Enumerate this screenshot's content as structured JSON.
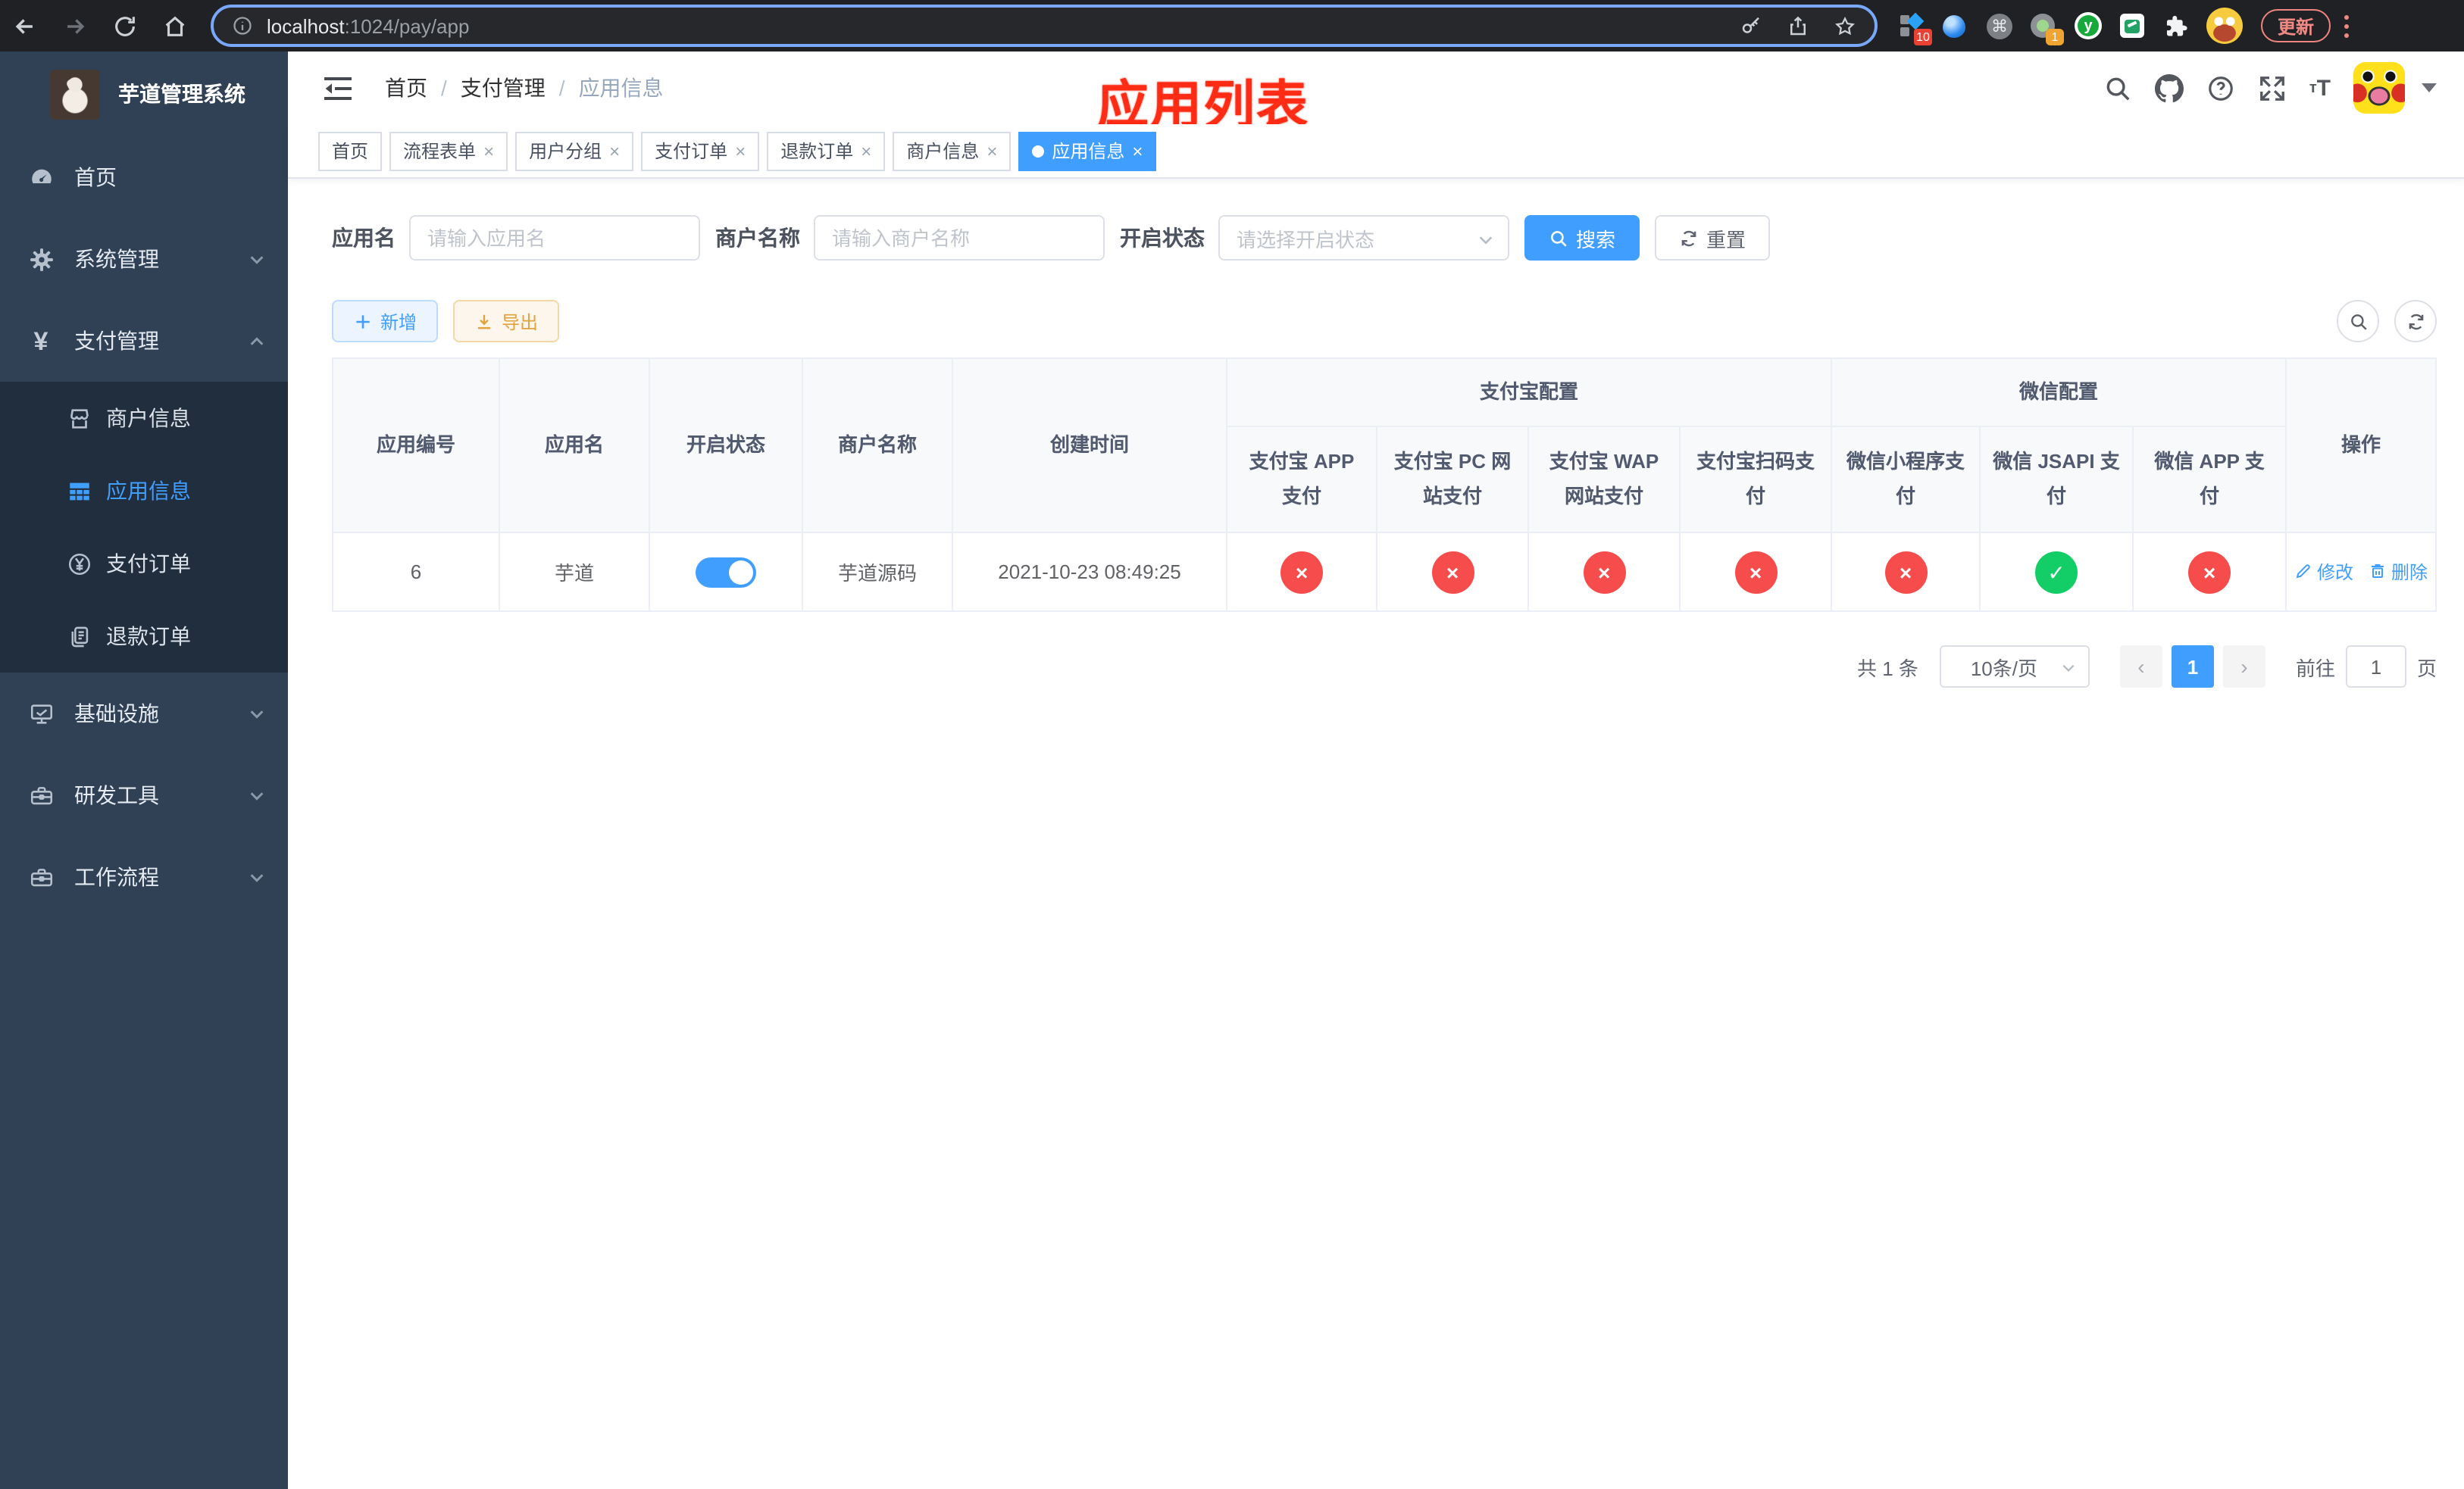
{
  "colors": {
    "primary": "#409eff",
    "danger": "#f64c4c",
    "success": "#13ce66",
    "warning": "#e2a23c",
    "annotation": "#fe2b15",
    "sidebar_bg": "#304156",
    "submenu_bg": "#212e3e"
  },
  "browser": {
    "url": {
      "host": "localhost",
      "rest": ":1024/pay/app"
    },
    "update_label": "更新",
    "ext_badge_blue": "10",
    "ext_badge_circle": "1",
    "ext_letter": "y"
  },
  "sidebar": {
    "title": "芋道管理系统",
    "items": [
      {
        "label": "首页"
      },
      {
        "label": "系统管理"
      },
      {
        "label": "支付管理"
      },
      {
        "label": "商户信息"
      },
      {
        "label": "应用信息"
      },
      {
        "label": "支付订单"
      },
      {
        "label": "退款订单"
      },
      {
        "label": "基础设施"
      },
      {
        "label": "研发工具"
      },
      {
        "label": "工作流程"
      }
    ]
  },
  "header": {
    "breadcrumb": [
      "首页",
      "支付管理",
      "应用信息"
    ],
    "separator": "/",
    "font_icon_small": "т",
    "font_icon_big": "T"
  },
  "annotation": {
    "text": "应用列表"
  },
  "tabs": {
    "items": [
      {
        "label": "首页"
      },
      {
        "label": "流程表单",
        "close": "×"
      },
      {
        "label": "用户分组",
        "close": "×"
      },
      {
        "label": "支付订单",
        "close": "×"
      },
      {
        "label": "退款订单",
        "close": "×"
      },
      {
        "label": "商户信息",
        "close": "×"
      },
      {
        "label": "应用信息",
        "close": "×"
      }
    ]
  },
  "filters": {
    "app_name": {
      "label": "应用名",
      "placeholder": "请输入应用名"
    },
    "merchant": {
      "label": "商户名称",
      "placeholder": "请输入商户名称"
    },
    "status": {
      "label": "开启状态",
      "placeholder": "请选择开启状态"
    },
    "search_label": "搜索",
    "reset_label": "重置"
  },
  "toolbar": {
    "add_label": "新增",
    "export_label": "导出"
  },
  "table": {
    "groups": {
      "alipay": "支付宝配置",
      "wechat": "微信配置"
    },
    "columns": [
      "应用编号",
      "应用名",
      "开启状态",
      "商户名称",
      "创建时间",
      "支付宝 APP 支付",
      "支付宝 PC 网站支付",
      "支付宝 WAP 网站支付",
      "支付宝扫码支付",
      "微信小程序支付",
      "微信 JSAPI 支付",
      "微信 APP 支付",
      "操作"
    ],
    "row": {
      "id": "6",
      "name": "芋道",
      "enabled": true,
      "merchant": "芋道源码",
      "created": "2021-10-23 08:49:25",
      "statuses": [
        {
          "state": "no",
          "glyph": "×"
        },
        {
          "state": "no",
          "glyph": "×"
        },
        {
          "state": "no",
          "glyph": "×"
        },
        {
          "state": "no",
          "glyph": "×"
        },
        {
          "state": "no",
          "glyph": "×"
        },
        {
          "state": "ok",
          "glyph": "✓"
        },
        {
          "state": "no",
          "glyph": "×"
        }
      ],
      "edit_label": "修改",
      "delete_label": "删除"
    }
  },
  "pagination": {
    "total": "共 1 条",
    "page_size": "10条/页",
    "prev": "‹",
    "page": "1",
    "next": "›",
    "goto_label": "前往",
    "goto_value": "1",
    "page_suffix": "页"
  }
}
